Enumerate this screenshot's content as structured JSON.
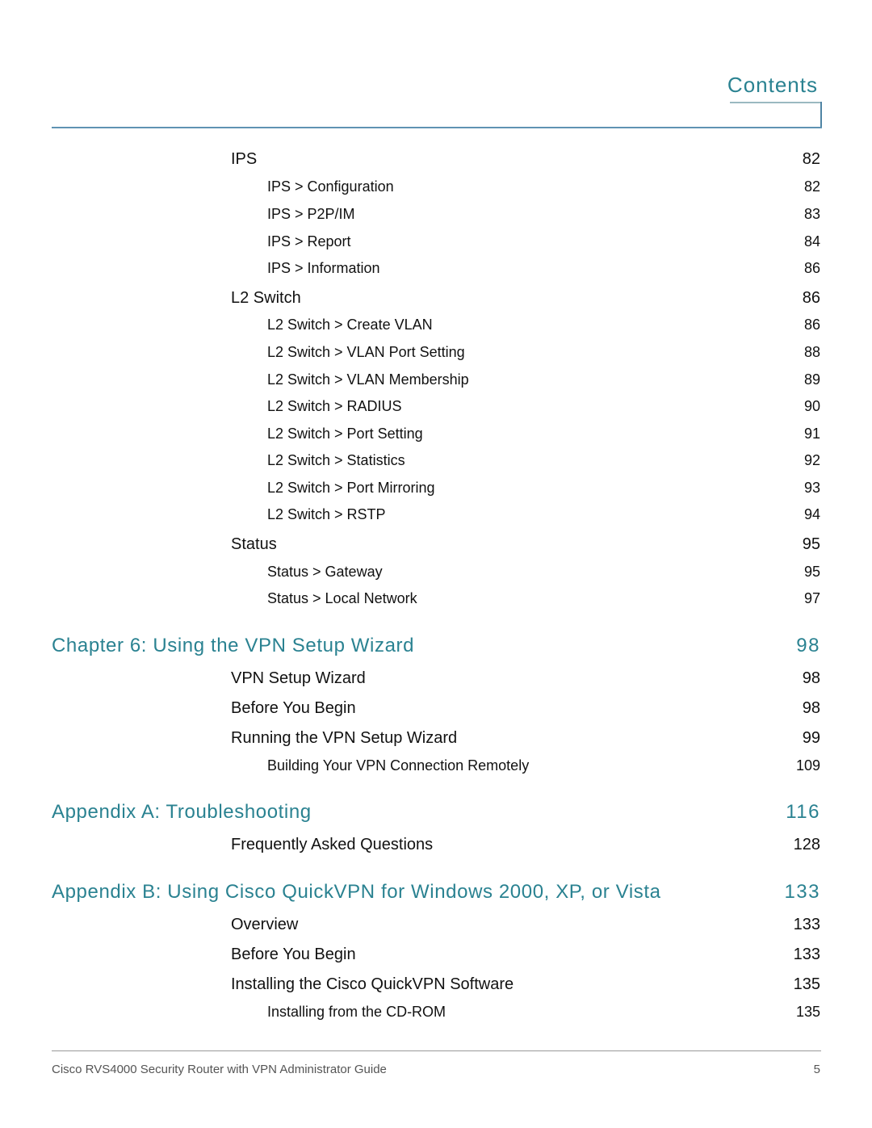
{
  "header": {
    "title": "Contents"
  },
  "toc": [
    {
      "level": 1,
      "label": "IPS",
      "page": "82"
    },
    {
      "level": 2,
      "label": "IPS > Configuration",
      "page": "82"
    },
    {
      "level": 2,
      "label": "IPS > P2P/IM",
      "page": "83"
    },
    {
      "level": 2,
      "label": "IPS > Report",
      "page": "84"
    },
    {
      "level": 2,
      "label": "IPS > Information",
      "page": "86"
    },
    {
      "level": 1,
      "label": "L2 Switch",
      "page": "86"
    },
    {
      "level": 2,
      "label": "L2 Switch > Create VLAN",
      "page": "86"
    },
    {
      "level": 2,
      "label": "L2 Switch > VLAN Port Setting",
      "page": "88"
    },
    {
      "level": 2,
      "label": "L2 Switch > VLAN Membership",
      "page": "89"
    },
    {
      "level": 2,
      "label": "L2 Switch > RADIUS",
      "page": "90"
    },
    {
      "level": 2,
      "label": "L2 Switch > Port Setting",
      "page": "91"
    },
    {
      "level": 2,
      "label": "L2 Switch > Statistics",
      "page": "92"
    },
    {
      "level": 2,
      "label": "L2 Switch > Port Mirroring",
      "page": "93"
    },
    {
      "level": 2,
      "label": "L2 Switch > RSTP",
      "page": "94"
    },
    {
      "level": 1,
      "label": "Status",
      "page": "95"
    },
    {
      "level": 2,
      "label": "Status > Gateway",
      "page": "95"
    },
    {
      "level": 2,
      "label": "Status > Local Network",
      "page": "97"
    },
    {
      "level": 0,
      "label": "Chapter 6: Using the VPN Setup Wizard",
      "page": "98"
    },
    {
      "level": 1,
      "label": "VPN Setup Wizard",
      "page": "98"
    },
    {
      "level": 1,
      "label": "Before You Begin",
      "page": "98"
    },
    {
      "level": 1,
      "label": "Running the VPN Setup Wizard",
      "page": "99"
    },
    {
      "level": 2,
      "label": "Building Your VPN Connection Remotely",
      "page": "109"
    },
    {
      "level": 0,
      "label": "Appendix A: Troubleshooting",
      "page": "116"
    },
    {
      "level": 1,
      "label": "Frequently Asked Questions",
      "page": "128"
    },
    {
      "level": 0,
      "label": "Appendix B: Using Cisco QuickVPN for Windows 2000, XP, or Vista",
      "page": "133"
    },
    {
      "level": 1,
      "label": "Overview",
      "page": "133"
    },
    {
      "level": 1,
      "label": "Before You Begin",
      "page": "133"
    },
    {
      "level": 1,
      "label": "Installing the Cisco QuickVPN Software",
      "page": "135"
    },
    {
      "level": 2,
      "label": "Installing from the CD-ROM",
      "page": "135"
    }
  ],
  "footer": {
    "text": "Cisco RVS4000 Security Router with VPN Administrator Guide",
    "page_number": "5"
  },
  "colors": {
    "accent": "#2a8291",
    "rule": "#5f93b3",
    "footer_text": "#555555"
  }
}
